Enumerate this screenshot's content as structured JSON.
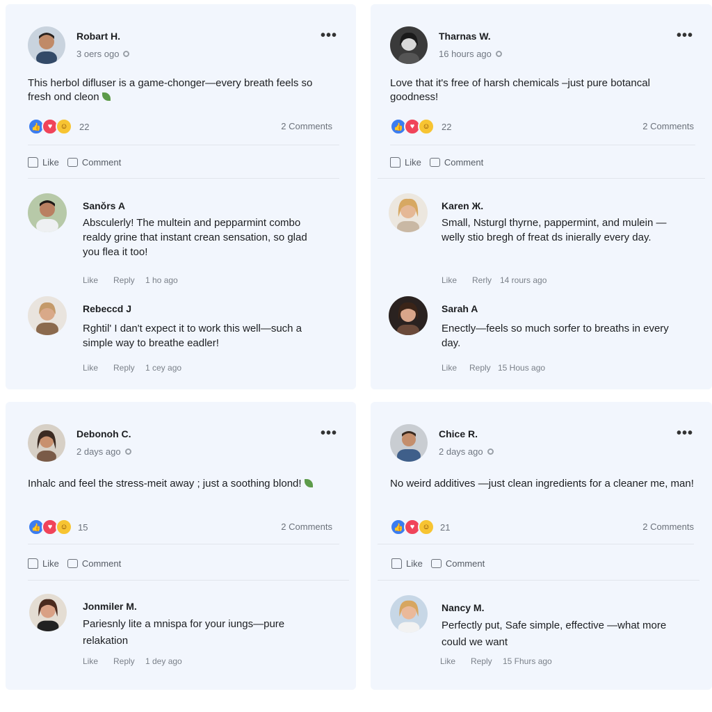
{
  "colors": {
    "card_background": "#f2f6fd",
    "like_blue": "#3b7df0",
    "love_red": "#f0445a",
    "haha_yellow": "#f7c432",
    "muted_text": "#707782"
  },
  "posts": [
    {
      "author": "Robart H.",
      "time": "3 oers ogo",
      "text": "This herbol difluser is a game-chonger—every breath feels so fresh ond cleon",
      "reaction_count": "22",
      "comments_label": "2 Comments",
      "like_label": "Like",
      "comment_label": "Comment",
      "comments": [
        {
          "author": "Sanǒrs A",
          "text": "Absculerly! The multein and pepparmint combo realdy grine that instant crean sensation, so glad you flea it too!",
          "like": "Like",
          "reply": "Reply",
          "time": "1 ho ago"
        },
        {
          "author": "Rebeccd J",
          "text": "Rghtil' I dan't expect it to work this well—such a simple way to breathe eadler!",
          "like": "Like",
          "reply": "Reply",
          "time": "1 cey ago"
        }
      ]
    },
    {
      "author": "Tharnas W.",
      "time": "16 hours ago",
      "text": "Love that it's free of harsh chemicals –just pure botancal goodness!",
      "reaction_count": "22",
      "comments_label": "2 Comments",
      "like_label": "Like",
      "comment_label": "Comment",
      "comments": [
        {
          "author": "Karen Ж.",
          "text": "Small, Nsturgl thyrne, pappermint, and mulein —welly stio bregh of freat ds inierally every day.",
          "like": "Like",
          "reply": "Rerly",
          "time": "14 rours ago"
        },
        {
          "author": "Sarah A",
          "text": "Enectly—feels so much sorfer to breaths in every day.",
          "like": "Like",
          "reply": "Reply",
          "time": "15 Hous ago"
        }
      ]
    },
    {
      "author": "Debonoh C.",
      "time": "2 days ago",
      "text": "Inhalc and feel the stress-meit away ; just a soothing blond!",
      "reaction_count": "15",
      "comments_label": "2 Comments",
      "like_label": "Like",
      "comment_label": "Comment",
      "comments": [
        {
          "author": "Jonmiler M.",
          "text": "Pariesnly lite a mnispa for your iungs—pure relakation",
          "like": "Like",
          "reply": "Reply",
          "time": "1 dey ago"
        }
      ]
    },
    {
      "author": "Chice R.",
      "time": "2 days ago",
      "text": "No weird additives —just clean ingredients for a cleaner me, man!",
      "reaction_count": "21",
      "comments_label": "2 Comments",
      "like_label": "Like",
      "comment_label": "Comment",
      "comments": [
        {
          "author": "Nancy M.",
          "text": "Perfectly put, Safe simple, effective —what more could we want",
          "like": "Like",
          "reply": "Reply",
          "time": "15 Fhurs ago"
        }
      ]
    }
  ]
}
